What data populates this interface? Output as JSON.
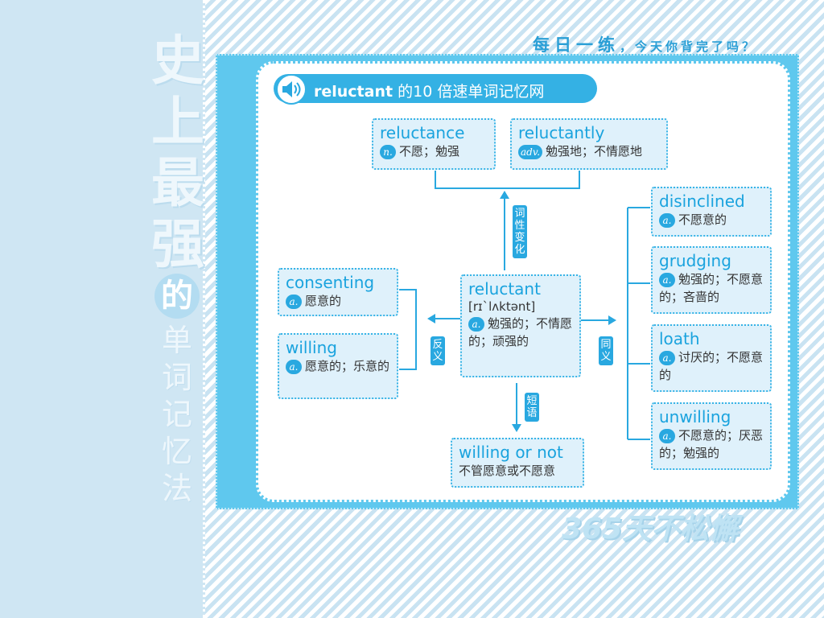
{
  "side_title": {
    "chars": [
      "史",
      "上",
      "最",
      "强"
    ],
    "circle": "的",
    "sub_chars": [
      "单",
      "词",
      "记",
      "忆",
      "法"
    ]
  },
  "slogan_top": {
    "main": "每日一练",
    "sub": "，今天你背完了吗？"
  },
  "slogan_bottom": "365天不松懈",
  "header": {
    "word": "reluctant",
    "rest": " 的10 倍速单词记忆网",
    "icon": "speaker-icon"
  },
  "center": {
    "word": "reluctant",
    "phonetic": "[rɪˋlʌktənt]",
    "pos": "a.",
    "meaning": "勉强的；不情愿的；顽强的"
  },
  "derivatives": [
    {
      "word": "reluctance",
      "pos": "n.",
      "meaning": "不愿；勉强"
    },
    {
      "word": "reluctantly",
      "pos": "adv.",
      "meaning": "勉强地；不情愿地"
    }
  ],
  "antonyms": [
    {
      "word": "consenting",
      "pos": "a.",
      "meaning": "愿意的"
    },
    {
      "word": "willing",
      "pos": "a.",
      "meaning": "愿意的；乐意的"
    }
  ],
  "synonyms": [
    {
      "word": "disinclined",
      "pos": "a.",
      "meaning": "不愿意的"
    },
    {
      "word": "grudging",
      "pos": "a.",
      "meaning": "勉强的；不愿意的；吝啬的"
    },
    {
      "word": "loath",
      "pos": "a.",
      "meaning": "讨厌的；不愿意的"
    },
    {
      "word": "unwilling",
      "pos": "a.",
      "meaning": "不愿意的；厌恶的；勉强的"
    }
  ],
  "phrase": {
    "word": "willing or not",
    "meaning": "不管愿意或不愿意"
  },
  "tags": {
    "derivation": "词性变化",
    "antonym": "反义",
    "synonym": "同义",
    "phrase": "短语"
  },
  "colors": {
    "accent": "#29a8e0",
    "frame": "#5fc8ee",
    "node_bg": "#dff1fb",
    "word": "#1aa3de"
  }
}
